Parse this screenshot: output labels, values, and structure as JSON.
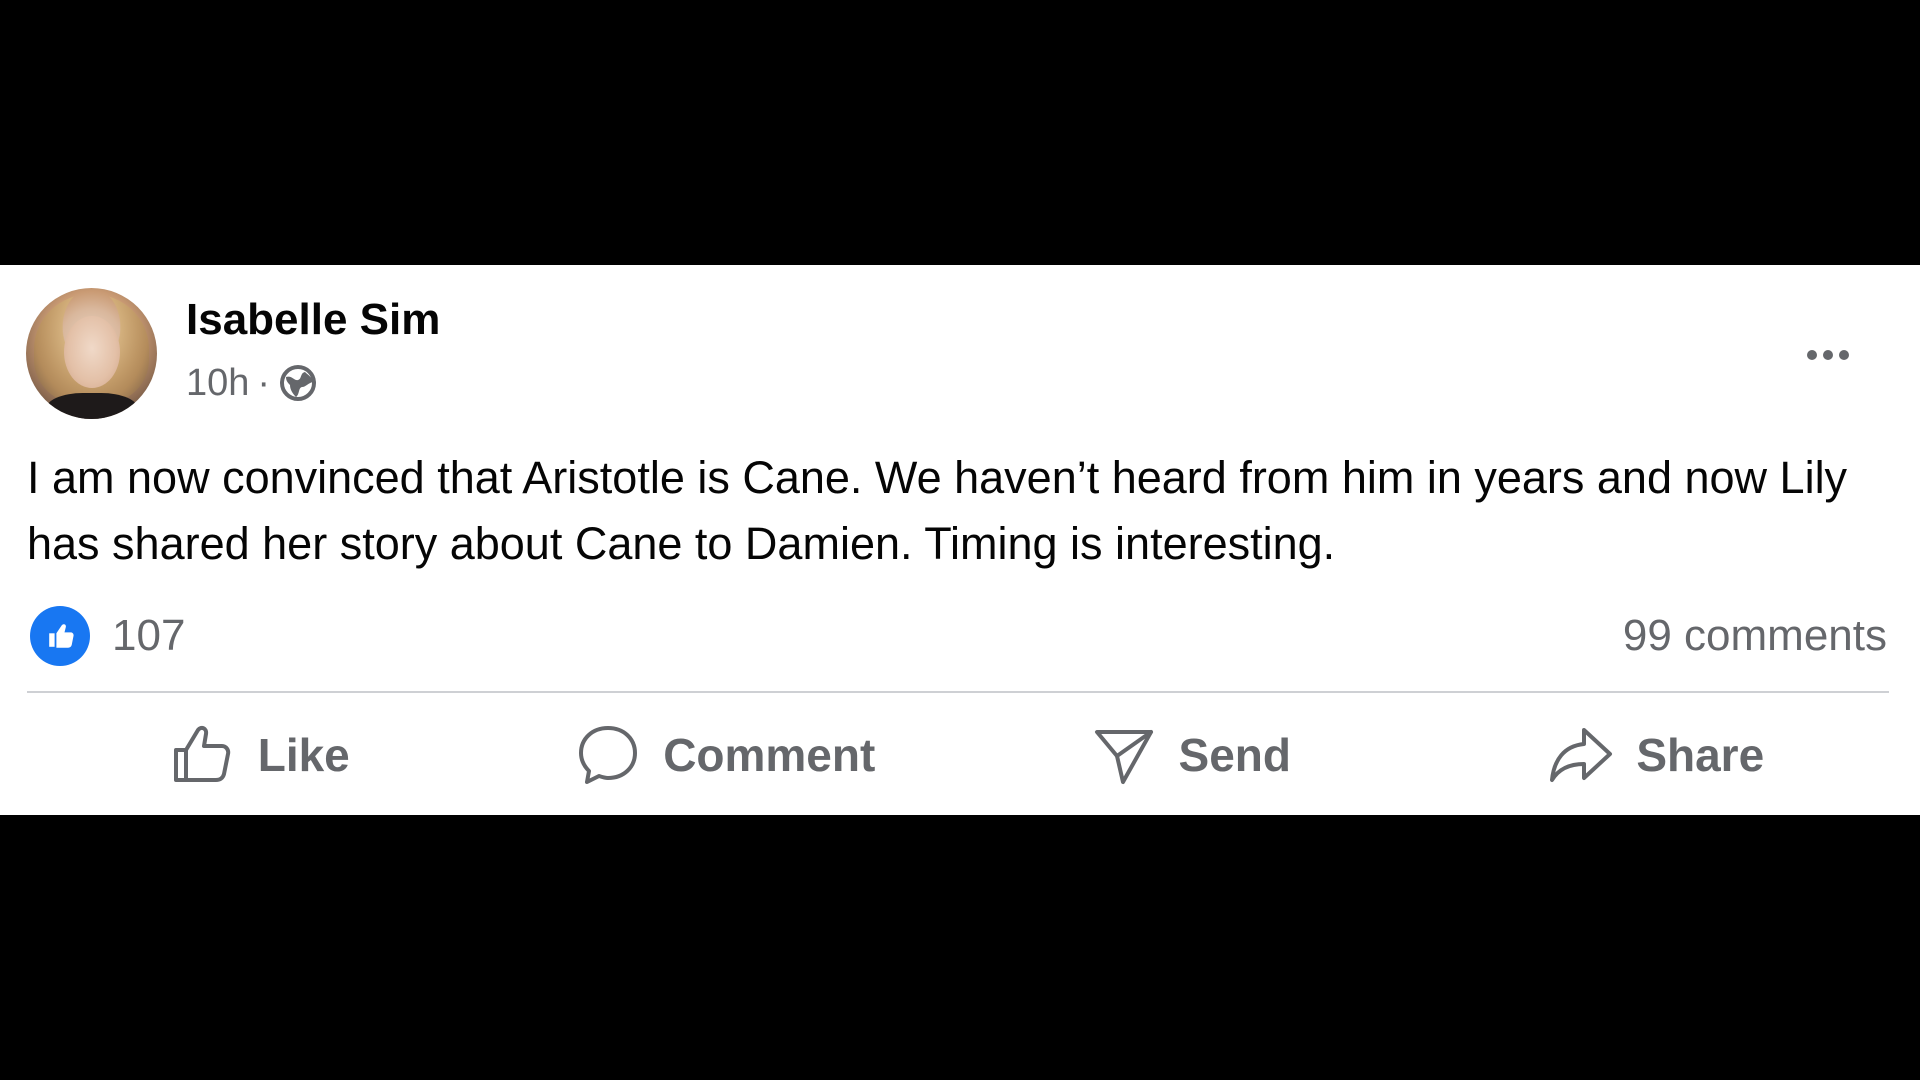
{
  "post": {
    "author": "Isabelle Sim",
    "time": "10h",
    "separator": "·",
    "audience_icon": "globe-icon",
    "more_icon": "more-dots-icon",
    "text": "I am now convinced that Aristotle is Cane. We haven’t heard from him in years and now Lily has shared her story about Cane to Damien. Timing is interesting."
  },
  "reactions": {
    "icon": "like-reaction-icon",
    "count": "107",
    "comments": "99 comments"
  },
  "actions": [
    {
      "label": "Like",
      "icon": "thumbs-up-icon"
    },
    {
      "label": "Comment",
      "icon": "comment-bubble-icon"
    },
    {
      "label": "Send",
      "icon": "send-icon"
    },
    {
      "label": "Share",
      "icon": "share-arrow-icon"
    }
  ],
  "colors": {
    "like_blue": "#1877f2",
    "secondary_text": "#65676b",
    "primary_text": "#050505",
    "divider": "#ced0d4"
  }
}
